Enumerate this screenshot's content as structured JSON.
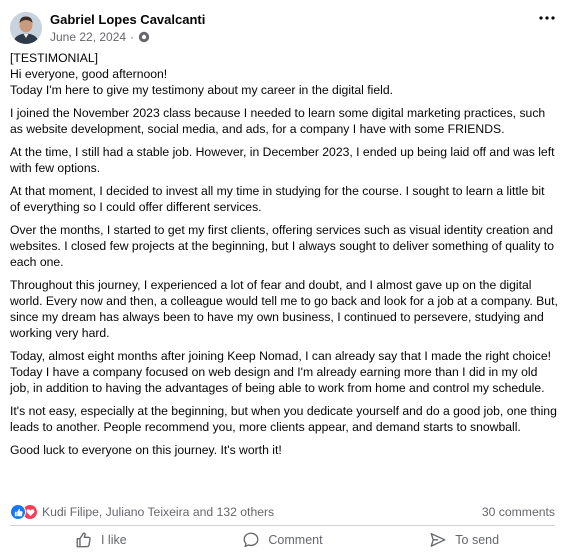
{
  "post": {
    "author": "Gabriel Lopes Cavalcanti",
    "date": "June 22, 2024",
    "separator": "·",
    "privacy_icon": "globe-icon",
    "more_icon": "more-horizontal-icon",
    "paragraphs": [
      "[TESTIMONIAL]",
      "Hi everyone, good afternoon!",
      "Today I'm here to give my testimony about my career in the digital field.",
      "I joined the November 2023 class because I needed to learn some digital marketing practices, such as website development, social media, and ads, for a company I have with some FRIENDS.",
      "At the time, I still had a stable job. However, in December 2023, I ended up being laid off and was left with few options.",
      "At that moment, I decided to invest all my time in studying for the course. I sought to learn a little bit of everything so I could offer different services.",
      "Over the months, I started to get my first clients, offering services such as visual identity creation and websites. I closed few projects at the beginning, but I always sought to deliver something of quality to each one.",
      "Throughout this journey, I experienced a lot of fear and doubt, and I almost gave up on the digital world. Every now and then, a colleague would tell me to go back and look for a job at a company. But, since my dream has always been to have my own business, I continued to persevere, studying and working very hard.",
      "Today, almost eight months after joining Keep Nomad, I can already say that I made the right choice! Today I have a company focused on web design and I'm already earning more than I did in my old job, in addition to having the advantages of being able to work from home and control my schedule.",
      "It's not easy, especially at the beginning, but when you dedicate yourself and do a good job, one thing leads to another. People recommend you, more clients appear, and demand starts to snowball.",
      "Good luck to everyone on this journey. It's worth it!"
    ],
    "reactions": {
      "icons": [
        "like-icon",
        "love-icon"
      ],
      "summary": "Kudi Filipe, Juliano Teixeira and 132 others",
      "comments": "30 comments"
    },
    "actions": {
      "like": "I like",
      "comment": "Comment",
      "send": "To send"
    },
    "colors": {
      "like": "#1877f2",
      "love": "#f33e58",
      "secondary_text": "#65676b"
    }
  }
}
